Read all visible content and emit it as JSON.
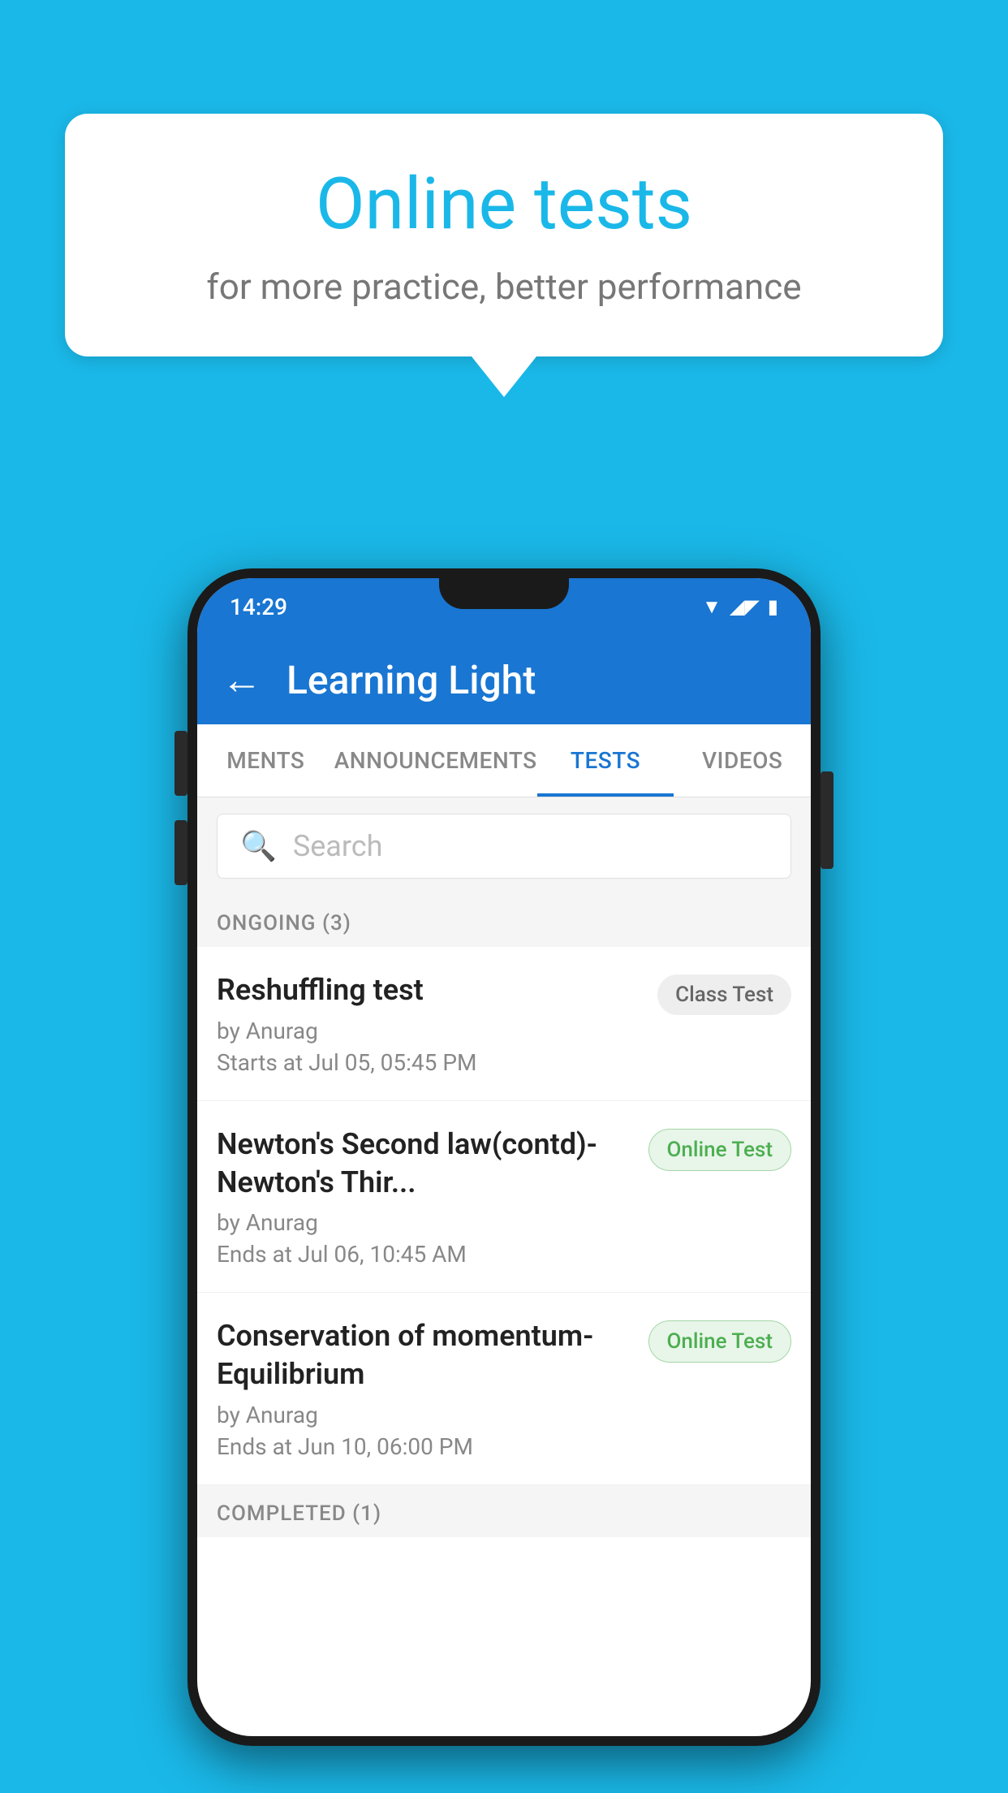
{
  "background": {
    "color": "#1ab8e8"
  },
  "speechBubble": {
    "title": "Online tests",
    "subtitle": "for more practice, better performance"
  },
  "phone": {
    "statusBar": {
      "time": "14:29"
    },
    "header": {
      "title": "Learning Light",
      "backLabel": "←"
    },
    "tabs": [
      {
        "label": "MENTS",
        "active": false
      },
      {
        "label": "ANNOUNCEMENTS",
        "active": false
      },
      {
        "label": "TESTS",
        "active": true
      },
      {
        "label": "VIDEOS",
        "active": false
      }
    ],
    "search": {
      "placeholder": "Search"
    },
    "ongoing": {
      "sectionLabel": "ONGOING (3)",
      "items": [
        {
          "name": "Reshuffling test",
          "author": "by Anurag",
          "time": "Starts at  Jul 05, 05:45 PM",
          "badge": "Class Test",
          "badgeType": "class"
        },
        {
          "name": "Newton's Second law(contd)-Newton's Thir...",
          "author": "by Anurag",
          "time": "Ends at  Jul 06, 10:45 AM",
          "badge": "Online Test",
          "badgeType": "online"
        },
        {
          "name": "Conservation of momentum-Equilibrium",
          "author": "by Anurag",
          "time": "Ends at  Jun 10, 06:00 PM",
          "badge": "Online Test",
          "badgeType": "online"
        }
      ]
    },
    "completed": {
      "sectionLabel": "COMPLETED (1)"
    }
  }
}
